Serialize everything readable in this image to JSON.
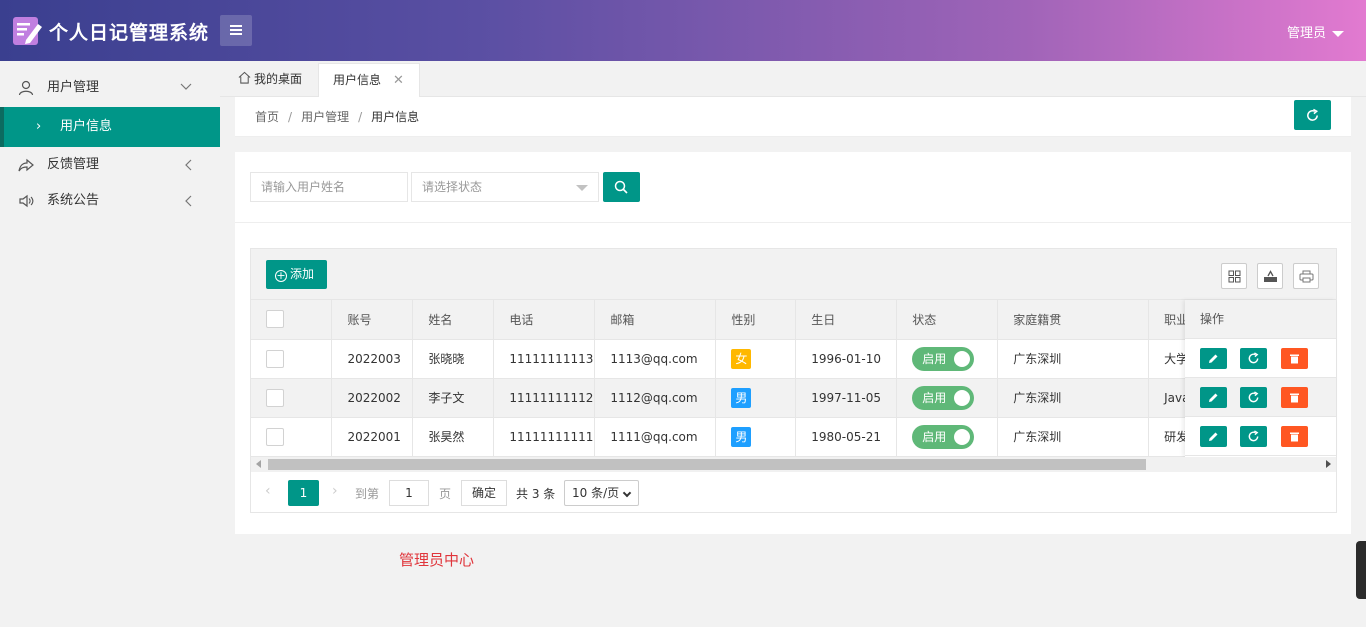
{
  "header": {
    "app_title": "个人日记管理系统",
    "user_label": "管理员"
  },
  "sidebar": {
    "items": [
      {
        "label": "用户管理",
        "icon": "user-icon",
        "expanded": true
      },
      {
        "label": "用户信息",
        "active": true
      },
      {
        "label": "反馈管理",
        "icon": "share-icon"
      },
      {
        "label": "系统公告",
        "icon": "speaker-icon"
      }
    ]
  },
  "tabs": [
    {
      "label": "我的桌面",
      "icon": "home-icon"
    },
    {
      "label": "用户信息",
      "active": true
    }
  ],
  "breadcrumb": [
    "首页",
    "用户管理",
    "用户信息"
  ],
  "search": {
    "name_placeholder": "请输入用户姓名",
    "status_placeholder": "请选择状态"
  },
  "toolbar": {
    "add_label": "添加"
  },
  "table": {
    "columns": [
      "账号",
      "姓名",
      "电话",
      "邮箱",
      "性别",
      "生日",
      "状态",
      "家庭籍贯",
      "职业"
    ],
    "ops_header": "操作",
    "rows": [
      {
        "account": "2022003",
        "name": "张晓晓",
        "phone": "11111111113",
        "email": "1113@qq.com",
        "gender": "女",
        "birthday": "1996-01-10",
        "status": "启用",
        "hometown": "广东深圳",
        "job": "大学"
      },
      {
        "account": "2022002",
        "name": "李子文",
        "phone": "11111111112",
        "email": "1112@qq.com",
        "gender": "男",
        "birthday": "1997-11-05",
        "status": "启用",
        "hometown": "广东深圳",
        "job": "Java"
      },
      {
        "account": "2022001",
        "name": "张昊然",
        "phone": "11111111111",
        "email": "1111@qq.com",
        "gender": "男",
        "birthday": "1980-05-21",
        "status": "启用",
        "hometown": "广东深圳",
        "job": "研发"
      }
    ]
  },
  "pager": {
    "current_page": "1",
    "goto_label": "到第",
    "page_input": "1",
    "page_unit": "页",
    "confirm_label": "确定",
    "total_label": "共 3 条",
    "per_page": "10 条/页"
  },
  "footer_note": "管理员中心",
  "colors": {
    "primary": "#009688",
    "danger": "#ff5722",
    "female": "#ffb800",
    "male": "#1e9fff",
    "switch_on": "#5fb878"
  }
}
